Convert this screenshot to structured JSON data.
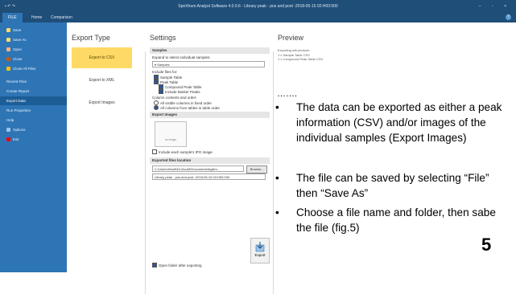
{
  "window": {
    "qat": "▪ ↶ ↷",
    "title": "SpeXtrum Analyst Software 4.0.0.6 - Library peak - pos and post -2018-05-15 02:H00:000",
    "winbtns": "– ▫ ×",
    "colors": {
      "titlebar": "#1f4e79",
      "sidebar": "#2e75b6",
      "selected_export": "#ffd966"
    }
  },
  "ribbon": {
    "tabs": [
      "FILE",
      "Home",
      "Comparison"
    ],
    "help": "?"
  },
  "sidebar": {
    "items": [
      {
        "label": "Save",
        "icon": "save-icon",
        "color": "#ffd966"
      },
      {
        "label": "Save As",
        "icon": "save-as-icon",
        "color": "#ffd966"
      },
      {
        "label": "Open",
        "icon": "folder-icon",
        "color": "#f4b183"
      },
      {
        "label": "Close",
        "icon": "close-file-icon",
        "color": "#c55a11"
      },
      {
        "label": "Close All Files",
        "icon": "close-all-icon",
        "color": "#ffc000"
      },
      {
        "label": "Recent Files",
        "icon": "",
        "color": ""
      },
      {
        "label": "Create Report",
        "icon": "",
        "color": ""
      },
      {
        "label": "Export Data",
        "icon": "",
        "color": "",
        "active": true
      },
      {
        "label": "Run Properties",
        "icon": "",
        "color": ""
      },
      {
        "label": "Help",
        "icon": "",
        "color": ""
      },
      {
        "label": "Options",
        "icon": "options-icon",
        "color": "#9dc3e6"
      },
      {
        "label": "Exit",
        "icon": "exit-icon",
        "color": "#ff0000"
      }
    ]
  },
  "export_type": {
    "heading": "Export Type",
    "options": [
      "Export to CSV",
      "Export to XML",
      "Export Images"
    ],
    "selected": 0
  },
  "settings": {
    "heading": "Settings",
    "samples_section": "Samples",
    "samples_hint": "Expand to select individual samples:",
    "samples_tree": "▾ Samples",
    "include_files_label": "Include files for:",
    "include_items": [
      {
        "label": "Sample Table",
        "checked": true,
        "indent": 0
      },
      {
        "label": "Peak Table",
        "checked": true,
        "indent": 0
      },
      {
        "label": "Compound Peak Table",
        "checked": true,
        "indent": 1
      },
      {
        "label": "Include Marker Peaks",
        "checked": true,
        "indent": 1
      }
    ],
    "columns_label": "Column contents and order:",
    "column_options": [
      {
        "label": "All visible columns in fixed order",
        "selected": false
      },
      {
        "label": "All columns from tables in table order",
        "selected": true
      }
    ],
    "export_images_section": "Export Images",
    "image_placeholder": "no image",
    "include_ipg_label": "Include each sample's IPG image",
    "file_location_section": "Exported files location",
    "path_value": "C:\\Users\\Hewit\\DL\\AcuM\\Documents\\Agilen...",
    "browse_label": "Browse...",
    "filename_value": "Library peak - pos and post -2018-05-15 02:H00:000",
    "open_folder_label": "Open folder after exporting",
    "export_button_label": "Export"
  },
  "preview": {
    "heading": "Preview",
    "lines": [
      "Exporting will produce:",
      "1 x Sample Table CSV",
      "1 x Compound Peak Table CSV"
    ]
  },
  "slide": {
    "dots": "…….",
    "bullets": [
      {
        "mark": "•",
        "text": "The data can be exported as either a peak information (CSV) and/or images of the individual samples (Export Images)"
      },
      {
        "mark": "•",
        "text": "The file can be saved by selecting “File” then “Save As”"
      },
      {
        "mark": "•",
        "text": "Choose a file name and folder, then sabe the file (fig.5)"
      }
    ],
    "slide_number": "5"
  }
}
